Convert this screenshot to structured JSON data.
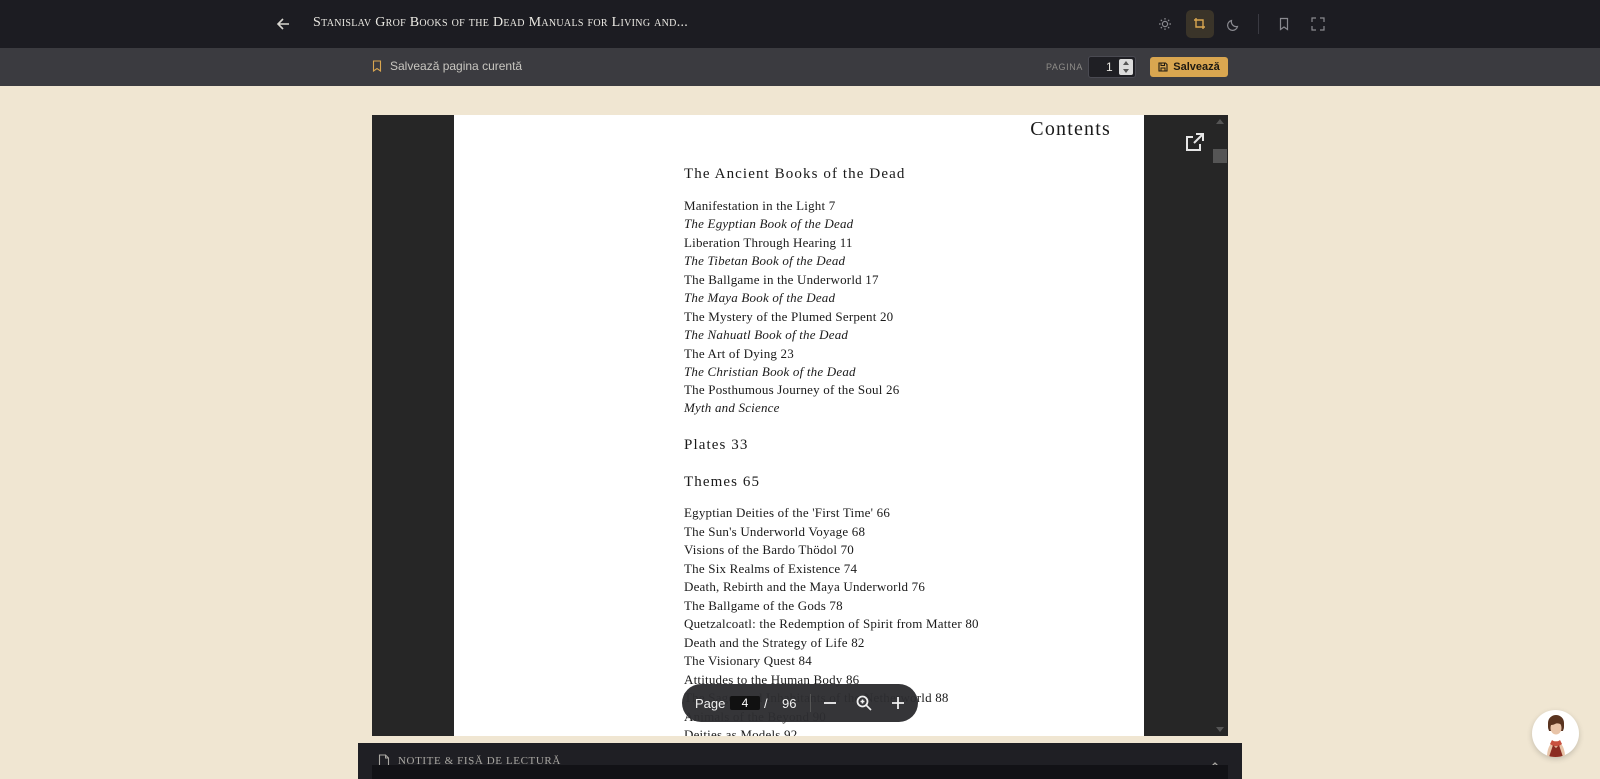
{
  "header": {
    "book_title": "Stanislav Grof Books of the Dead Manuals for Living and...",
    "icons": [
      "arrow-left-icon",
      "sun-icon",
      "crop-icon",
      "moon-icon",
      "bookmark-icon",
      "fullscreen-icon"
    ],
    "active_theme": "sepia"
  },
  "toolbar": {
    "save_current_label": "Salvează pagina curentă",
    "page_label": "PAGINA",
    "page_value": "1",
    "save_button_label": "Salvează",
    "accent_color": "#d9a650"
  },
  "document": {
    "heading": "Contents",
    "entries": [
      {
        "text": "The Ancient Books of the Dead",
        "style": "heading"
      },
      {
        "text": "Manifestation in the Light 7",
        "style": "normal"
      },
      {
        "text": "The Egyptian Book of the Dead",
        "style": "italic"
      },
      {
        "text": "Liberation Through Hearing 11",
        "style": "normal"
      },
      {
        "text": "The Tibetan Book of the Dead",
        "style": "italic"
      },
      {
        "text": "The Ballgame in the Underworld 17",
        "style": "normal"
      },
      {
        "text": "The Maya Book of the Dead",
        "style": "italic"
      },
      {
        "text": "The Mystery of the Plumed Serpent 20",
        "style": "normal"
      },
      {
        "text": "The Nahuatl Book of the Dead",
        "style": "italic"
      },
      {
        "text": "The Art of Dying 23",
        "style": "normal"
      },
      {
        "text": "The Christian Book of the Dead",
        "style": "italic"
      },
      {
        "text": "The Posthumous Journey of the Soul 26",
        "style": "normal"
      },
      {
        "text": "Myth and Science",
        "style": "italic"
      },
      {
        "text": "Plates 33",
        "style": "heading"
      },
      {
        "text": "Themes 65",
        "style": "heading"
      },
      {
        "text": "Egyptian Deities of the 'First Time' 66",
        "style": "normal"
      },
      {
        "text": "The Sun's Underworld Voyage 68",
        "style": "normal"
      },
      {
        "text": "Visions of the Bardo Thödol 70",
        "style": "normal"
      },
      {
        "text": "The Six Realms of Existence 74",
        "style": "normal"
      },
      {
        "text": "Death, Rebirth and the Maya Underworld 76",
        "style": "normal"
      },
      {
        "text": "The Ballgame of the Gods 78",
        "style": "normal"
      },
      {
        "text": "Quetzalcoatl: the Redemption of Spirit from Matter 80",
        "style": "normal"
      },
      {
        "text": "Death and the Strategy of Life 82",
        "style": "normal"
      },
      {
        "text": "The Visionary Quest 84",
        "style": "normal"
      },
      {
        "text": "Attitudes to the Human Body 86",
        "style": "normal"
      },
      {
        "text": "The Sages and Inhabitants of the Netherworld 88",
        "style": "normal"
      },
      {
        "text": "Animals of the Beyond 90",
        "style": "normal"
      },
      {
        "text": "Deities as Models 92",
        "style": "normal"
      }
    ]
  },
  "pager": {
    "page_label": "Page",
    "current_page": "4",
    "separator": "/",
    "total_pages": "96"
  },
  "notes": {
    "title": "Notițe & fișă de lectură"
  }
}
